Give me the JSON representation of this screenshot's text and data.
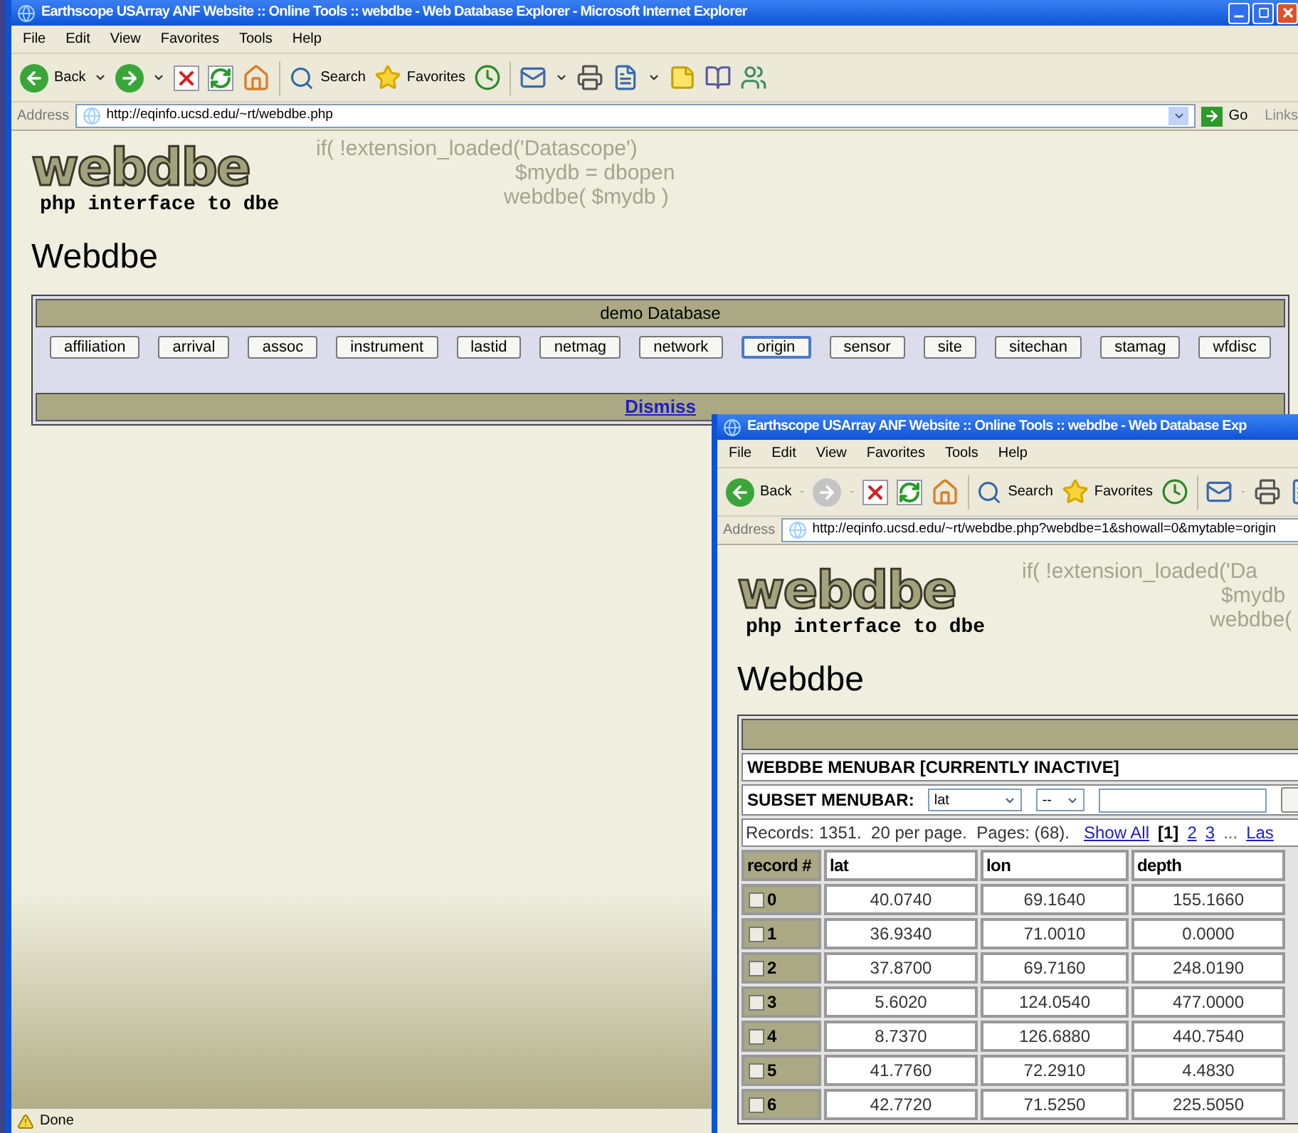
{
  "main_window": {
    "title": "Earthscope USArray ANF Website :: Online Tools :: webdbe - Web Database Explorer - Microsoft Internet Explorer",
    "menu_items": [
      "File",
      "Edit",
      "View",
      "Favorites",
      "Tools",
      "Help"
    ],
    "toolbar": {
      "back": "Back",
      "search": "Search",
      "favorites": "Favorites",
      "forward_disabled": false
    },
    "address_label": "Address",
    "url": "http://eqinfo.ucsd.edu/~rt/webdbe.php",
    "go": "Go",
    "links": "Links",
    "logo": {
      "word": "webdbe",
      "tagline": "php interface to dbe"
    },
    "code_lines": [
      "if( !extension_loaded('Datascope')",
      "$mydb = dbopen",
      "webdbe( $mydb )"
    ],
    "heading": "Webdbe",
    "database_panel": {
      "title": "demo Database",
      "tables": [
        {
          "label": "affiliation",
          "selected": false
        },
        {
          "label": "arrival",
          "selected": false
        },
        {
          "label": "assoc",
          "selected": false
        },
        {
          "label": "instrument",
          "selected": false
        },
        {
          "label": "lastid",
          "selected": false
        },
        {
          "label": "netmag",
          "selected": false
        },
        {
          "label": "network",
          "selected": false
        },
        {
          "label": "origin",
          "selected": true
        },
        {
          "label": "sensor",
          "selected": false
        },
        {
          "label": "site",
          "selected": false
        },
        {
          "label": "sitechan",
          "selected": false
        },
        {
          "label": "stamag",
          "selected": false
        },
        {
          "label": "wfdisc",
          "selected": false
        }
      ],
      "dismiss": "Dismiss"
    },
    "status": "Done"
  },
  "front_window": {
    "title": "Earthscope USArray ANF Website :: Online Tools :: webdbe - Web Database Exp",
    "menu_items": [
      "File",
      "Edit",
      "View",
      "Favorites",
      "Tools",
      "Help"
    ],
    "toolbar": {
      "back": "Back",
      "search": "Search",
      "favorites": "Favorites",
      "forward_disabled": true
    },
    "address_label": "Address",
    "url": "http://eqinfo.ucsd.edu/~rt/webdbe.php?webdbe=1&showall=0&mytable=origin",
    "logo": {
      "word": "webdbe",
      "tagline": "php interface to dbe"
    },
    "code_lines": [
      "if( !extension_loaded('Da",
      "$mydb",
      "webdbe("
    ],
    "heading": "Webdbe",
    "table": {
      "menubar": "WEBDBE MENUBAR [CURRENTLY INACTIVE]",
      "subset_label": "SUBSET MENUBAR:",
      "field_select": "lat",
      "operator_select": "--",
      "records_text": "Records: 1351.  20 per page.  Pages: (68).",
      "show_all": "Show All",
      "pages": [
        {
          "label": "[1]",
          "selected": true
        },
        {
          "label": "2",
          "selected": false
        },
        {
          "label": "3",
          "selected": false
        }
      ],
      "ellipsis": "...",
      "last": "Las",
      "columns": [
        "record #",
        "lat",
        "lon",
        "depth"
      ],
      "rows": [
        {
          "record": "0",
          "checked": false,
          "lat": "40.0740",
          "lon": "69.1640",
          "depth": "155.1660"
        },
        {
          "record": "1",
          "checked": false,
          "lat": "36.9340",
          "lon": "71.0010",
          "depth": "0.0000"
        },
        {
          "record": "2",
          "checked": false,
          "lat": "37.8700",
          "lon": "69.7160",
          "depth": "248.0190"
        },
        {
          "record": "3",
          "checked": false,
          "lat": "5.6020",
          "lon": "124.0540",
          "depth": "477.0000"
        },
        {
          "record": "4",
          "checked": false,
          "lat": "8.7370",
          "lon": "126.6880",
          "depth": "440.7540"
        },
        {
          "record": "5",
          "checked": false,
          "lat": "41.7760",
          "lon": "72.2910",
          "depth": "4.4830"
        },
        {
          "record": "6",
          "checked": false,
          "lat": "42.7720",
          "lon": "71.5250",
          "depth": "225.5050"
        }
      ]
    }
  }
}
